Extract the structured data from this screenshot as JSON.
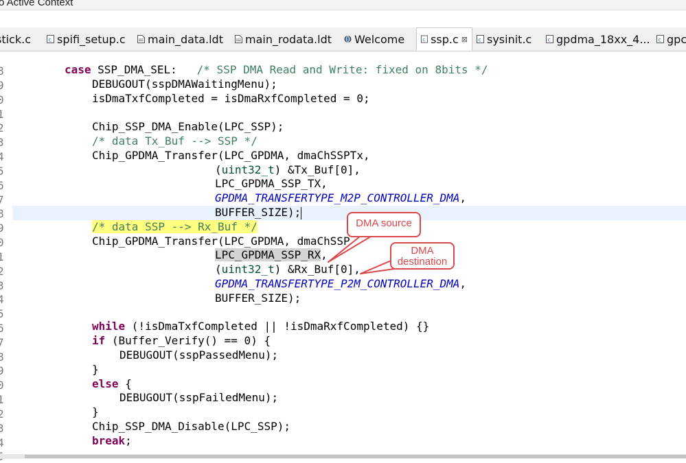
{
  "window_title": "o Active Context",
  "tabs": [
    {
      "label": "stick.c",
      "icon": "c-file-icon",
      "active": false
    },
    {
      "label": "spifi_setup.c",
      "icon": "c-file-icon",
      "active": false
    },
    {
      "label": "main_data.ldt",
      "icon": "text-file-icon",
      "active": false
    },
    {
      "label": "main_rodata.ldt",
      "icon": "text-file-icon",
      "active": false
    },
    {
      "label": "Welcome",
      "icon": "welcome-globe-icon",
      "active": false
    },
    {
      "label": "ssp.c",
      "icon": "c-file-icon",
      "active": true,
      "close": "⊠"
    },
    {
      "label": "sysinit.c",
      "icon": "c-file-icon",
      "active": false
    },
    {
      "label": "gpdma_18xx_4...",
      "icon": "c-file-icon",
      "active": false
    },
    {
      "label": "gpc",
      "icon": "c-file-icon",
      "active": false
    }
  ],
  "gutter_digits": [
    "8",
    "9",
    "0",
    "1",
    "2",
    "3",
    "4",
    "5",
    "6",
    "7",
    "8",
    "9",
    "0",
    "1",
    "2",
    "3",
    "4",
    "5",
    "6",
    "7",
    "8",
    "9",
    "0",
    "1",
    "2",
    "3",
    "4",
    "5"
  ],
  "code": {
    "l1_kw": "case",
    "l1_text": " SSP_DMA_SEL:   ",
    "l1_comment": "/* SSP DMA Read and Write: fixed on 8bits */",
    "l2": "DEBUGOUT(sspDMAWaitingMenu);",
    "l3": "isDmaTxfCompleted = isDmaRxfCompleted = 0;",
    "l5": "Chip_SSP_DMA_Enable(LPC_SSP);",
    "l6_comment": "/* data Tx_Buf --> SSP */",
    "l7": "Chip_GPDMA_Transfer(LPC_GPDMA, dmaChSSPTx,",
    "l8_type": "uint32_t",
    "l8_rest": ") &Tx_Buf[0],",
    "l9": "LPC_GPDMA_SSP_TX,",
    "l10_macro": "GPDMA_TRANSFERTYPE_M2P_CONTROLLER_DMA",
    "l11": "BUFFER_SIZE);",
    "l12_comment": "/* data SSP --> Rx_Buf */",
    "l13": "Chip_GPDMA_Transfer(LPC_GPDMA, dmaChSSP",
    "l14_hl": "LPC_GPDMA_SSP_RX",
    "l15_type": "uint32_t",
    "l15_rest": ") &Rx_Buf[0],",
    "l16_macro": "GPDMA_TRANSFERTYPE_P2M_CONTROLLER_DMA",
    "l17": "BUFFER_SIZE);",
    "l19_kw": "while",
    "l19_rest": " (!isDmaTxfCompleted || !isDmaRxfCompleted) {}",
    "l20_kw": "if",
    "l20_rest": " (Buffer_Verify() == 0) {",
    "l21": "DEBUGOUT(sspPassedMenu);",
    "l22": "}",
    "l23_kw": "else",
    "l23_rest": " {",
    "l24": "DEBUGOUT(sspFailedMenu);",
    "l25": "}",
    "l26": "Chip_SSP_DMA_Disable(LPC_SSP);",
    "l27_kw": "break",
    "l27_rest": ";"
  },
  "callouts": {
    "source": "DMA  source",
    "destination_line1": "DMA",
    "destination_line2": "destination"
  },
  "colors": {
    "callout_border": "#d9474a",
    "keyword": "#7f0055",
    "comment": "#3f7f5f",
    "macro": "#0000c0",
    "current_line": "#e8f2fe",
    "highlight_yellow": "#ffff80"
  }
}
